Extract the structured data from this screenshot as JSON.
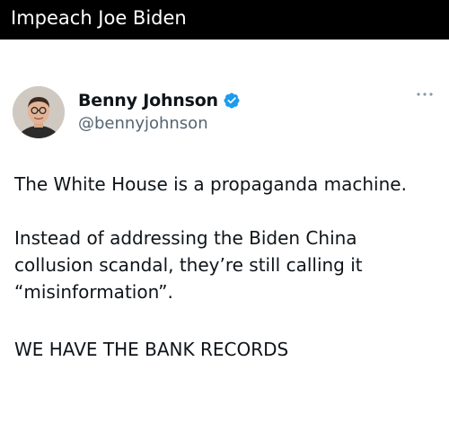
{
  "header": {
    "title": "Impeach Joe Biden"
  },
  "tweet": {
    "author": {
      "display_name": "Benny Johnson",
      "handle": "@bennyjohnson",
      "verified": true
    },
    "paragraphs": [
      "The White House is a propaganda machine.",
      "Instead of addressing the Biden China\ncollusion scandal, they’re still calling it\n“misinformation”.",
      "WE HAVE THE BANK RECORDS"
    ]
  },
  "colors": {
    "topbar_bg": "#000000",
    "verified_badge": "#1d9bf0",
    "handle_text": "#536471"
  },
  "icons": {
    "verified": "verified-badge-icon",
    "more": "more-options-icon"
  }
}
